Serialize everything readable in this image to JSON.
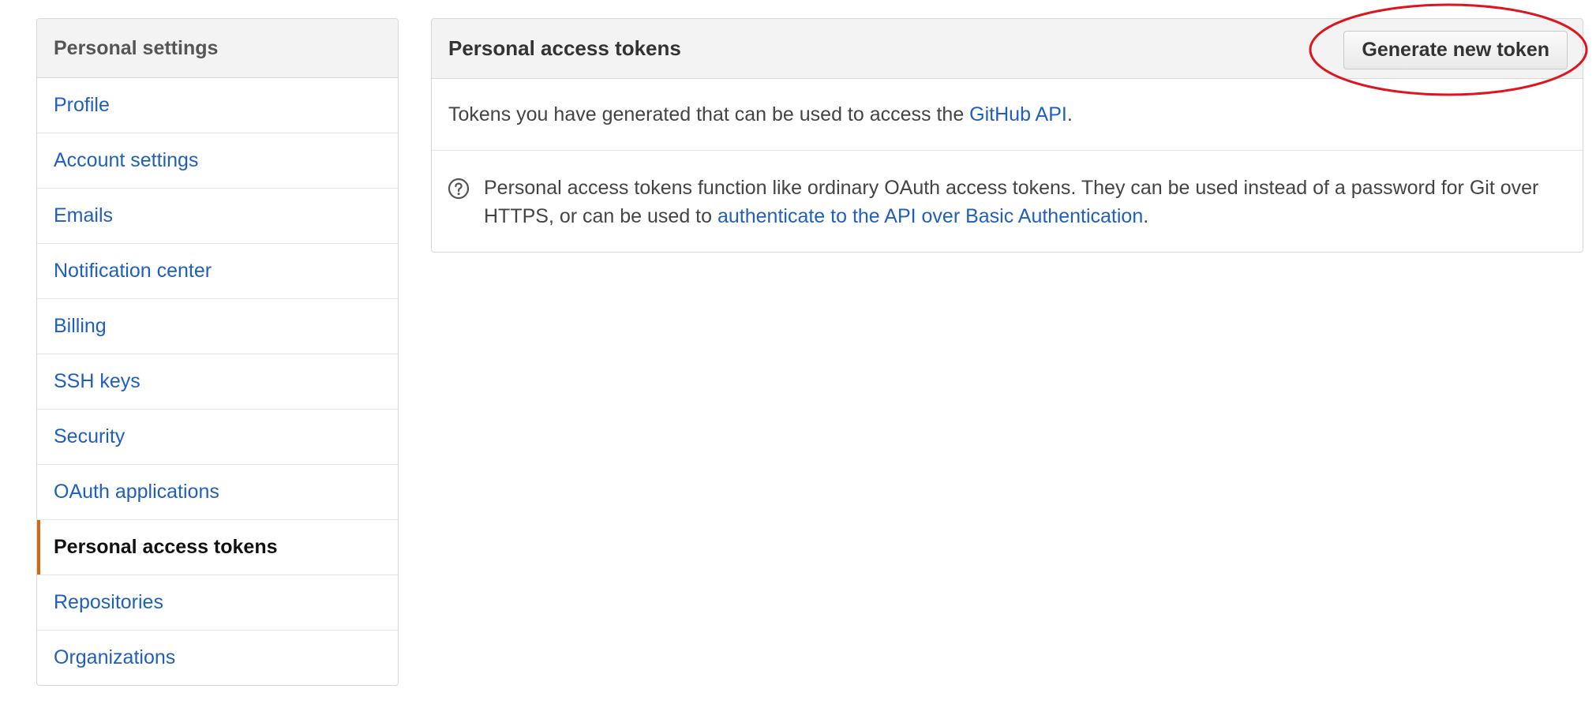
{
  "sidebar": {
    "title": "Personal settings",
    "items": [
      {
        "label": "Profile"
      },
      {
        "label": "Account settings"
      },
      {
        "label": "Emails"
      },
      {
        "label": "Notification center"
      },
      {
        "label": "Billing"
      },
      {
        "label": "SSH keys"
      },
      {
        "label": "Security"
      },
      {
        "label": "OAuth applications"
      },
      {
        "label": "Personal access tokens",
        "selected": true
      },
      {
        "label": "Repositories"
      },
      {
        "label": "Organizations"
      }
    ]
  },
  "panel": {
    "title": "Personal access tokens",
    "generate_button": "Generate new token",
    "intro_text": "Tokens you have generated that can be used to access the ",
    "intro_link": "GitHub API",
    "intro_end": ".",
    "note_text": "Personal access tokens function like ordinary OAuth access tokens. They can be used instead of a password for Git over HTTPS, or can be used to ",
    "note_link": "authenticate to the API over Basic Authentication",
    "note_end": "."
  },
  "icons": {
    "help": "question-circle-icon"
  },
  "colors": {
    "link": "#1f5fbf",
    "selected_accent": "#d26911",
    "annotation": "#e0141e"
  }
}
